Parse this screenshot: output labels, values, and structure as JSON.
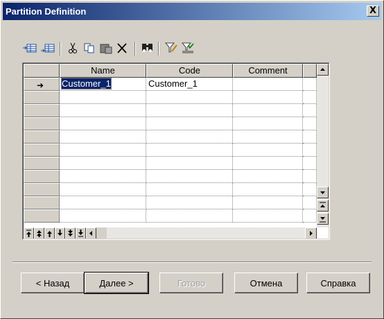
{
  "window": {
    "title": "Partition Definition",
    "close_glyph": "X"
  },
  "toolbar": {
    "icons": [
      "insert-row-icon",
      "add-row-icon",
      "cut-icon",
      "copy-icon",
      "paste-icon",
      "delete-icon",
      "find-icon",
      "filter-icon",
      "filter-options-icon"
    ]
  },
  "grid": {
    "columns": [
      "Name",
      "Code",
      "Comment"
    ],
    "rows": [
      {
        "marker": "➜",
        "name": "Customer_1",
        "code": "Customer_1",
        "comment": ""
      }
    ]
  },
  "buttons": {
    "back": "< Назад",
    "next": "Далее >",
    "finish": "Готово",
    "cancel": "Отмена",
    "help": "Справка"
  },
  "colors": {
    "title_gradient_start": "#0a246a",
    "title_gradient_end": "#a6caf0",
    "face": "#d4d0c8",
    "selection": "#0a246a"
  }
}
